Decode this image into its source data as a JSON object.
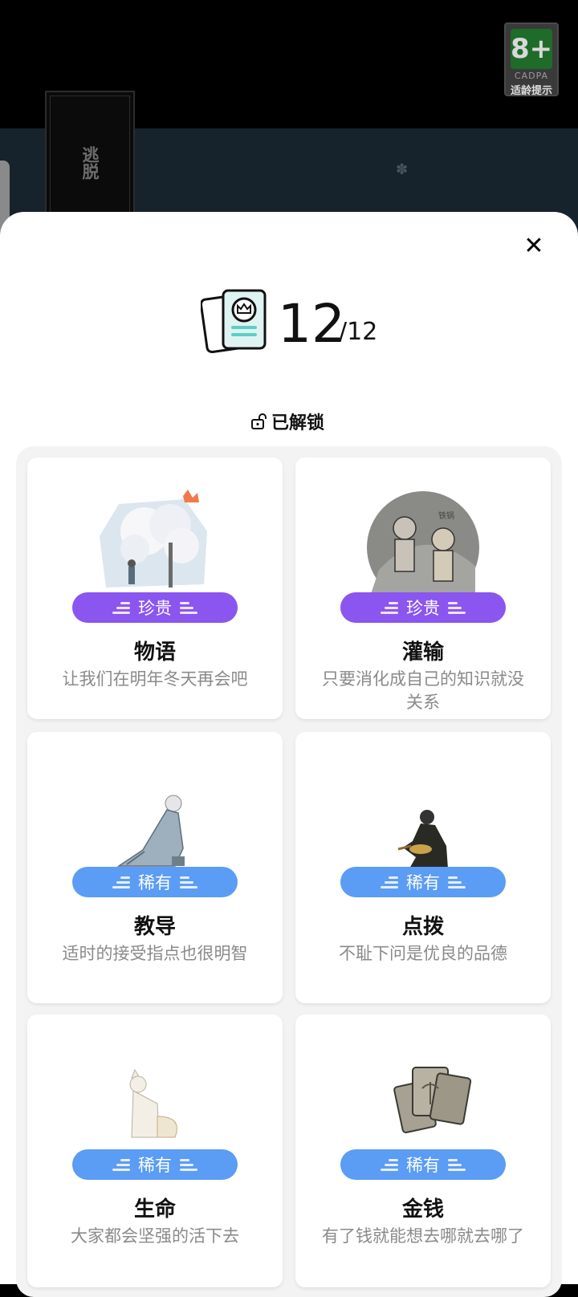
{
  "background": {
    "age_rating": {
      "age": "8+",
      "org": "CADPA",
      "tip": "适龄提示"
    },
    "escape_label": "逃脱"
  },
  "header": {
    "unlocked_count": "12",
    "total_count": "/12",
    "unlocked_label": "已解锁"
  },
  "colors": {
    "precious": "#8b55f0",
    "rare": "#5b9cf5"
  },
  "cards": [
    {
      "rarity": "珍贵",
      "title": "物语",
      "desc": "让我们在明年冬天再会吧"
    },
    {
      "rarity": "珍贵",
      "title": "灌输",
      "desc": "只要消化成自己的知识就没关系"
    },
    {
      "rarity": "稀有",
      "title": "教导",
      "desc": "适时的接受指点也很明智"
    },
    {
      "rarity": "稀有",
      "title": "点拨",
      "desc": "不耻下问是优良的品德"
    },
    {
      "rarity": "稀有",
      "title": "生命",
      "desc": "大家都会坚强的活下去"
    },
    {
      "rarity": "稀有",
      "title": "金钱",
      "desc": "有了钱就能想去哪就去哪了"
    }
  ]
}
